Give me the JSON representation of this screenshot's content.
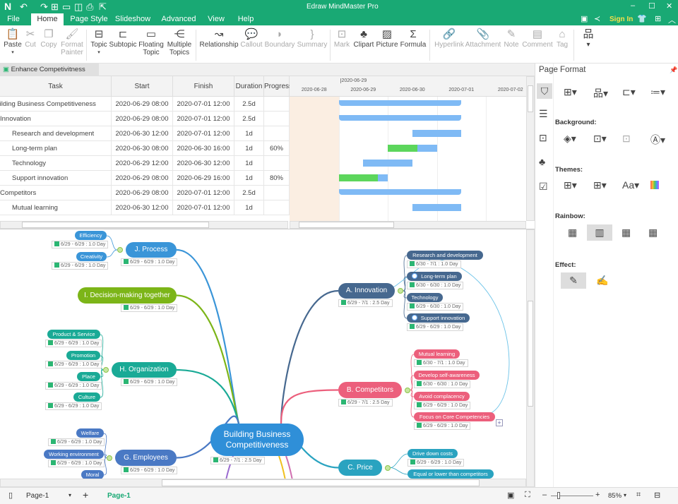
{
  "app": {
    "title": "Edraw MindMaster Pro",
    "sign_in": "Sign In"
  },
  "menu": [
    "File",
    "Home",
    "Page Style",
    "Slideshow",
    "Advanced",
    "View",
    "Help"
  ],
  "ribbon": [
    {
      "label": "Paste",
      "icon": "clipboard-icon",
      "enabled": true
    },
    {
      "label": "Cut",
      "icon": "scissors-icon",
      "enabled": false
    },
    {
      "label": "Copy",
      "icon": "copy-icon",
      "enabled": false
    },
    {
      "label": "Format Painter",
      "icon": "brush-icon",
      "enabled": false
    },
    {
      "label": "Topic",
      "icon": "topic-icon",
      "enabled": true
    },
    {
      "label": "Subtopic",
      "icon": "subtopic-icon",
      "enabled": true
    },
    {
      "label": "Floating Topic",
      "icon": "floating-topic-icon",
      "enabled": true
    },
    {
      "label": "Multiple Topics",
      "icon": "multiple-topics-icon",
      "enabled": true
    },
    {
      "label": "Relationship",
      "icon": "relationship-icon",
      "enabled": true
    },
    {
      "label": "Callout",
      "icon": "callout-icon",
      "enabled": false
    },
    {
      "label": "Boundary",
      "icon": "boundary-icon",
      "enabled": false
    },
    {
      "label": "Summary",
      "icon": "summary-icon",
      "enabled": false
    },
    {
      "label": "Mark",
      "icon": "mark-icon",
      "enabled": false
    },
    {
      "label": "Clipart",
      "icon": "clipart-icon",
      "enabled": true
    },
    {
      "label": "Picture",
      "icon": "picture-icon",
      "enabled": true
    },
    {
      "label": "Formula",
      "icon": "sigma-icon",
      "enabled": true
    },
    {
      "label": "Hyperlink",
      "icon": "link-icon",
      "enabled": false
    },
    {
      "label": "Attachment",
      "icon": "paperclip-icon",
      "enabled": false
    },
    {
      "label": "Note",
      "icon": "note-icon",
      "enabled": false
    },
    {
      "label": "Comment",
      "icon": "comment-icon",
      "enabled": false
    },
    {
      "label": "Tag",
      "icon": "tag-icon",
      "enabled": false
    }
  ],
  "document_tab": "Enhance Competivitness",
  "gantt": {
    "columns": [
      "Task",
      "Start",
      "Finish",
      "Duration",
      "Progress"
    ],
    "timeline_top": "2020-06-29",
    "dates": [
      "2020-06-28",
      "2020-06-29",
      "2020-06-30",
      "2020-07-01",
      "2020-07-02"
    ],
    "rows": [
      {
        "task": "Building Business Competitiveness",
        "indent": 0,
        "start": "2020-06-29 08:00",
        "finish": "2020-07-01 12:00",
        "duration": "2.5d",
        "progress": "",
        "summary": true
      },
      {
        "task": "Innovation",
        "indent": 1,
        "start": "2020-06-29 08:00",
        "finish": "2020-07-01 12:00",
        "duration": "2.5d",
        "progress": "",
        "summary": true
      },
      {
        "task": "Research and development",
        "indent": 2,
        "start": "2020-06-30 12:00",
        "finish": "2020-07-01 12:00",
        "duration": "1d",
        "progress": ""
      },
      {
        "task": "Long-term plan",
        "indent": 2,
        "start": "2020-06-30 08:00",
        "finish": "2020-06-30 16:00",
        "duration": "1d",
        "progress": "60%"
      },
      {
        "task": "Technology",
        "indent": 2,
        "start": "2020-06-29 12:00",
        "finish": "2020-06-30 12:00",
        "duration": "1d",
        "progress": ""
      },
      {
        "task": "Support innovation",
        "indent": 2,
        "start": "2020-06-29 08:00",
        "finish": "2020-06-29 16:00",
        "duration": "1d",
        "progress": "80%"
      },
      {
        "task": "Competitors",
        "indent": 1,
        "start": "2020-06-29 08:00",
        "finish": "2020-07-01 12:00",
        "duration": "2.5d",
        "progress": "",
        "summary": true
      },
      {
        "task": "Mutual learning",
        "indent": 2,
        "start": "2020-06-30 12:00",
        "finish": "2020-07-01 12:00",
        "duration": "1d",
        "progress": ""
      }
    ]
  },
  "mindmap": {
    "central": {
      "label": "Building Business Competitiveness",
      "date": "6/29 - 7/1 : 2.5 Day",
      "color": "#2f8fd8"
    },
    "branches": [
      {
        "label": "J. Process",
        "date": "6/29 - 6/29 : 1.0 Day",
        "color": "#3a95d8",
        "children": [
          {
            "label": "Efficiency",
            "date": "6/29 - 6/29 : 1.0 Day"
          },
          {
            "label": "Creativity",
            "date": "6/29 - 6/29 : 1.0 Day"
          }
        ]
      },
      {
        "label": "I. Decision-making together",
        "date": "6/29 - 6/29 : 1.0 Day",
        "color": "#7cb518",
        "children": []
      },
      {
        "label": "H. Organization",
        "date": "6/29 - 6/29 : 1.0 Day",
        "color": "#1aaa96",
        "children": [
          {
            "label": "Product & Service",
            "date": "6/29 - 6/29 : 1.0 Day"
          },
          {
            "label": "Promotion",
            "date": "6/29 - 6/29 : 1.0 Day"
          },
          {
            "label": "Place",
            "date": "6/29 - 6/29 : 1.0 Day"
          },
          {
            "label": "Culture",
            "date": "6/29 - 6/29 : 1.0 Day"
          }
        ]
      },
      {
        "label": "G. Employees",
        "date": "6/29 - 6/29 : 1.0 Day",
        "color": "#4a79c4",
        "children": [
          {
            "label": "Welfare",
            "date": "6/29 - 6/29 : 1.0 Day"
          },
          {
            "label": "Working environment",
            "date": "6/29 - 6/29 : 1.0 Day"
          },
          {
            "label": "Moral"
          }
        ]
      },
      {
        "label": "A. Innovation",
        "date": "6/29 - 7/1 : 2.5 Day",
        "color": "#46688f",
        "children": [
          {
            "label": "Research and development",
            "date": "6/30 - 7/1 : 1.0 Day"
          },
          {
            "label": "Long-term plan",
            "date": "6/30 - 6/30 : 1.0 Day",
            "progress_icon": true
          },
          {
            "label": "Technology",
            "date": "6/29 - 6/30 : 1.0 Day"
          },
          {
            "label": "Support innovation",
            "date": "6/29 - 6/29 : 1.0 Day",
            "progress_icon": true
          }
        ]
      },
      {
        "label": "B. Competitors",
        "date": "6/29 - 7/1 : 2.5 Day",
        "color": "#ec5f7c",
        "children": [
          {
            "label": "Mutual learning",
            "date": "6/30 - 7/1 : 1.0 Day"
          },
          {
            "label": "Develop self-awareness",
            "date": "6/30 - 6/30 : 1.0 Day"
          },
          {
            "label": "Avoid complacency",
            "date": "6/29 - 6/29 : 1.0 Day"
          },
          {
            "label": "Focus on Core Competencies",
            "date": "6/29 - 6/29 : 1.0 Day"
          }
        ]
      },
      {
        "label": "C. Price",
        "color": "#2aa3c0",
        "children": [
          {
            "label": "Drive down costs",
            "date": "6/29 - 6/29 : 1.0 Day"
          },
          {
            "label": "Equal or lower than competitors"
          }
        ]
      }
    ]
  },
  "panel": {
    "title": "Page Format",
    "background": "Background:",
    "themes": "Themes:",
    "rainbow": "Rainbow:",
    "effect": "Effect:"
  },
  "status": {
    "page_select": "Page-1",
    "page_tab": "Page-1",
    "zoom": "85%",
    "zoom_fraction": 0.15
  }
}
